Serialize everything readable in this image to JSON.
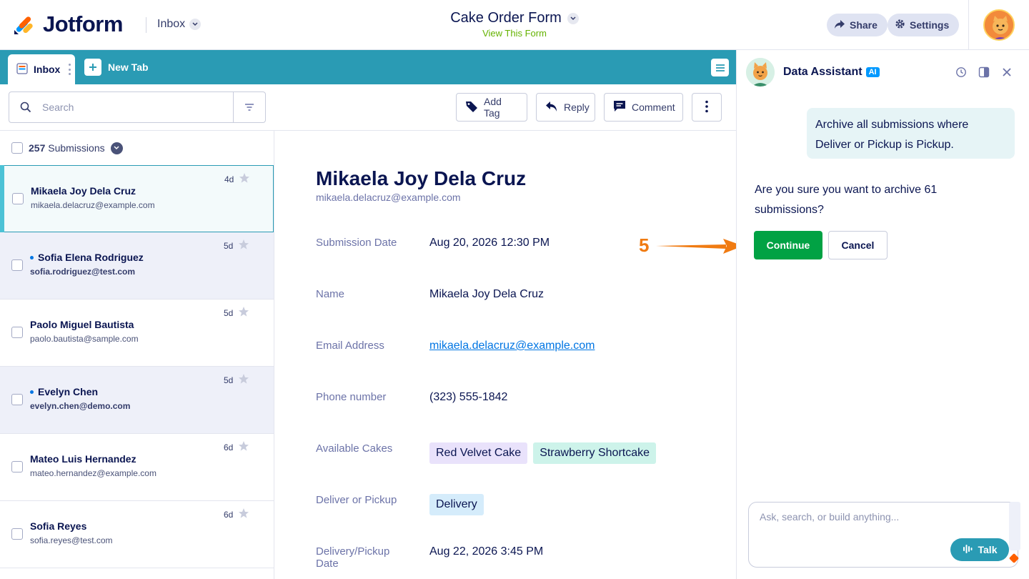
{
  "header": {
    "brand": "Jotform",
    "inbox_label": "Inbox",
    "form_title": "Cake Order Form",
    "view_form": "View This Form",
    "share_label": "Share",
    "settings_label": "Settings"
  },
  "tabs": {
    "inbox_label": "Inbox",
    "new_tab_label": "New Tab"
  },
  "toolbar": {
    "search_placeholder": "Search",
    "add_tag": "Add Tag",
    "reply": "Reply",
    "comment": "Comment"
  },
  "list": {
    "count": "257",
    "count_suffix": "Submissions",
    "rows": [
      {
        "name": "Mikaela Joy Dela Cruz",
        "email": "mikaela.delacruz@example.com",
        "age": "4d",
        "unread": false,
        "selected": true
      },
      {
        "name": "Sofia Elena Rodriguez",
        "email": "sofia.rodriguez@test.com",
        "age": "5d",
        "unread": true,
        "selected": false
      },
      {
        "name": "Paolo Miguel Bautista",
        "email": "paolo.bautista@sample.com",
        "age": "5d",
        "unread": false,
        "selected": false
      },
      {
        "name": "Evelyn Chen",
        "email": "evelyn.chen@demo.com",
        "age": "5d",
        "unread": true,
        "selected": false
      },
      {
        "name": "Mateo Luis Hernandez",
        "email": "mateo.hernandez@example.com",
        "age": "6d",
        "unread": false,
        "selected": false
      },
      {
        "name": "Sofia Reyes",
        "email": "sofia.reyes@test.com",
        "age": "6d",
        "unread": false,
        "selected": false
      }
    ]
  },
  "detail": {
    "name": "Mikaela Joy Dela Cruz",
    "email": "mikaela.delacruz@example.com",
    "fields": {
      "submission_date_label": "Submission Date",
      "submission_date": "Aug 20, 2026 12:30 PM",
      "name_label": "Name",
      "name": "Mikaela Joy Dela Cruz",
      "email_label": "Email Address",
      "email": "mikaela.delacruz@example.com",
      "phone_label": "Phone number",
      "phone": "(323) 555-1842",
      "cakes_label": "Available Cakes",
      "cakes": [
        "Red Velvet Cake",
        "Strawberry Shortcake"
      ],
      "deliver_label": "Deliver or Pickup",
      "deliver": "Delivery",
      "date_label_1": "Delivery/Pickup",
      "date_label_2": "Date",
      "date": "Aug 22, 2026 3:45 PM"
    }
  },
  "assistant": {
    "title": "Data Assistant",
    "ai_badge": "AI",
    "user_message": "Archive all submissions where Deliver or Pickup is Pickup.",
    "bot_message": "Are you sure you want to archive 61 submissions?",
    "continue_label": "Continue",
    "cancel_label": "Cancel",
    "input_placeholder": "Ask, search, or build anything...",
    "talk_label": "Talk"
  },
  "annotation": {
    "step": "5"
  },
  "colors": {
    "brand_navy": "#0a1551",
    "tab_teal": "#2a9bb4",
    "continue_green": "#01a244",
    "link_blue": "#0075e3",
    "chip_purple": "#e9e2fb",
    "chip_mint": "#cdf3ea",
    "chip_blue": "#d5ecfb",
    "annotation_orange": "#f07b12"
  }
}
